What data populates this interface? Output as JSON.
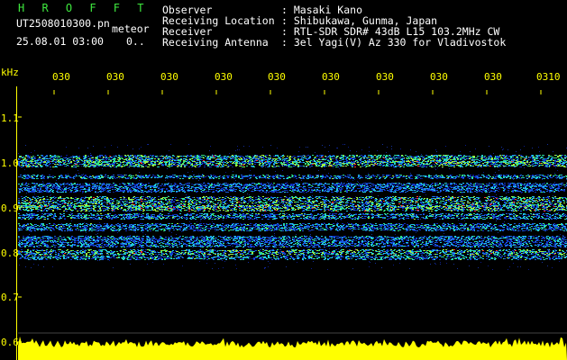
{
  "header": {
    "app_title": "H R O F F T",
    "filename": "UT2508010300.pn",
    "mode": "meteor",
    "datetime": "25.08.01 03:00",
    "status_value": "0..",
    "info_labels": [
      "Observer",
      "Receiving Location",
      "Receiver",
      "Receiving Antenna"
    ],
    "info_values": [
      ": Masaki Kano",
      ": Shibukawa, Gunma, Japan",
      ": RTL-SDR SDR# 43dB L15 103.2MHz CW",
      ": 3el Yagi(V) Az 330 for Vladivostok"
    ]
  },
  "time_axis": {
    "labels": [
      "030",
      "030",
      "030",
      "030",
      "030",
      "030",
      "030",
      "030",
      "030",
      "0310"
    ]
  },
  "freq_axis": {
    "unit": "kHz",
    "labels": [
      "1.1",
      "1.0",
      "0.9",
      "0.8",
      "0.7",
      "0.6"
    ]
  },
  "colors": {
    "background": "#000000",
    "text": "#ffffff",
    "title": "#3ee83e",
    "axis": "#ffff00",
    "signal_low": "#0a1a8a",
    "signal_mid": "#20c8e0",
    "signal_high": "#ff3030",
    "power_trace": "#ffff00"
  }
}
